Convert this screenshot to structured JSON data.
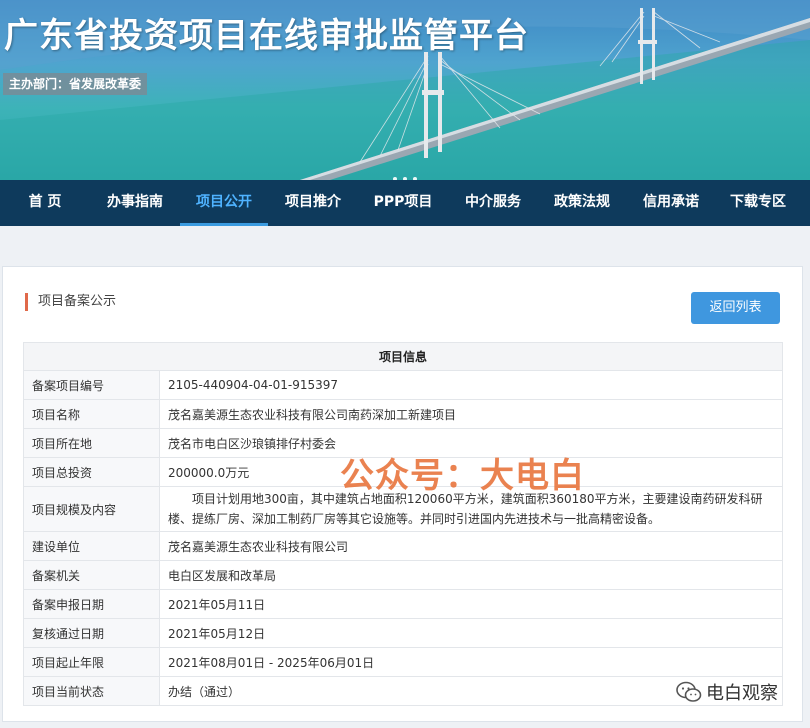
{
  "banner": {
    "title": "广东省投资项目在线审批监管平台",
    "sponsor": "主办部门：省发展改革委"
  },
  "nav": {
    "items": [
      {
        "label": "首 页"
      },
      {
        "label": "办事指南"
      },
      {
        "label": "项目公开",
        "active": true
      },
      {
        "label": "项目推介"
      },
      {
        "label": "PPP项目"
      },
      {
        "label": "中介服务"
      },
      {
        "label": "政策法规"
      },
      {
        "label": "信用承诺"
      },
      {
        "label": "下载专区"
      }
    ]
  },
  "panel": {
    "title": "项目备案公示",
    "back_label": "返回列表"
  },
  "table": {
    "header": "项目信息",
    "rows": [
      {
        "label": "备案项目编号",
        "value": "2105-440904-04-01-915397"
      },
      {
        "label": "项目名称",
        "value": "茂名嘉美源生态农业科技有限公司南药深加工新建项目"
      },
      {
        "label": "项目所在地",
        "value": "茂名市电白区沙琅镇排仔村委会"
      },
      {
        "label": "项目总投资",
        "value": "200000.0万元"
      },
      {
        "label": "项目规模及内容",
        "value": "项目计划用地300亩，其中建筑占地面积120060平方米，建筑面积360180平方米，主要建设南药研发科研楼、提练厂房、深加工制药厂房等其它设施等。并同时引进国内先进技术与一批高精密设备。"
      },
      {
        "label": "建设单位",
        "value": "茂名嘉美源生态农业科技有限公司"
      },
      {
        "label": "备案机关",
        "value": "电白区发展和改革局"
      },
      {
        "label": "备案申报日期",
        "value": "2021年05月11日"
      },
      {
        "label": "复核通过日期",
        "value": "2021年05月12日"
      },
      {
        "label": "项目起止年限",
        "value": "2021年08月01日 - 2025年06月01日"
      },
      {
        "label": "项目当前状态",
        "value": "办结（通过）"
      }
    ]
  },
  "watermark": "公众号：大电白",
  "wechat_mark": "电白观察",
  "colors": {
    "nav_bg": "#0e3a5c",
    "nav_active": "#4fb3ff",
    "button_bg": "#3f97df",
    "accent_bar": "#e0694a",
    "watermark": "#e8753e"
  }
}
